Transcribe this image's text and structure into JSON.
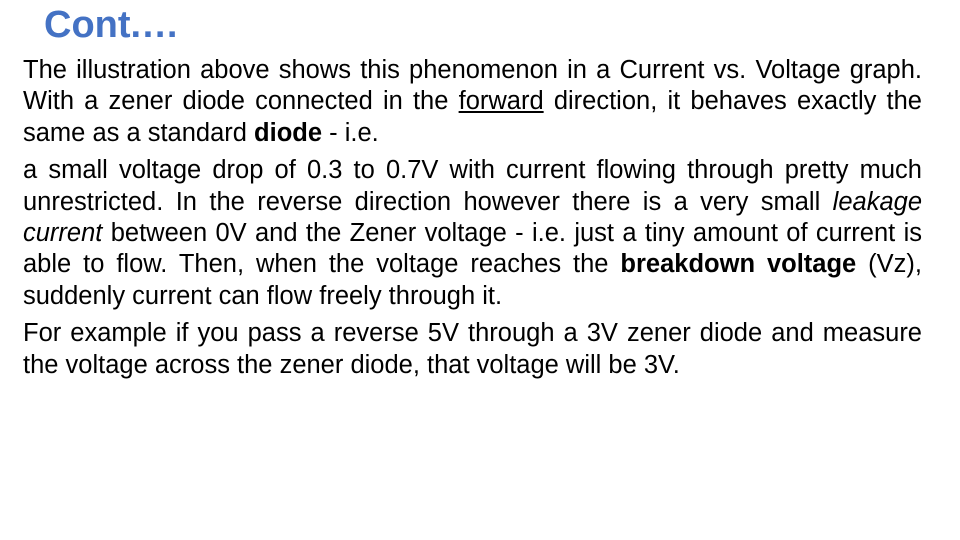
{
  "slide": {
    "title": "Cont.…",
    "title_color": "#4472C4",
    "background_color": "#FFFFFF",
    "text_color": "#000000",
    "paragraphs": [
      {
        "id": "p1",
        "runs": [
          {
            "text": "The illustration above shows this phenomenon in a Current vs. Voltage graph. With a zener diode connected in the ",
            "style": "normal"
          },
          {
            "text": "forward",
            "style": "underline"
          },
          {
            "text": " direction, it behaves exactly the same as a standard ",
            "style": "normal"
          },
          {
            "text": "diode",
            "style": "bold"
          },
          {
            "text": " - i.e.",
            "style": "normal"
          }
        ]
      },
      {
        "id": "p2",
        "runs": [
          {
            "text": "a small voltage drop of 0.3 to 0.7V with current flowing through pretty much unrestricted. In the reverse direction however there is a very small ",
            "style": "normal"
          },
          {
            "text": "leakage current",
            "style": "italic"
          },
          {
            "text": " between 0V and the Zener voltage - i.e. just a tiny amount of current is able to flow. Then, when the voltage reaches the ",
            "style": "normal"
          },
          {
            "text": "breakdown  voltage",
            "style": "bold"
          },
          {
            "text": " (Vz), suddenly current can flow freely through it.",
            "style": "normal"
          }
        ]
      },
      {
        "id": "p3",
        "runs": [
          {
            "text": "For example if you pass a reverse 5V through a 3V zener diode and measure the voltage across the zener diode, that voltage will be 3V.",
            "style": "normal"
          }
        ]
      }
    ]
  }
}
